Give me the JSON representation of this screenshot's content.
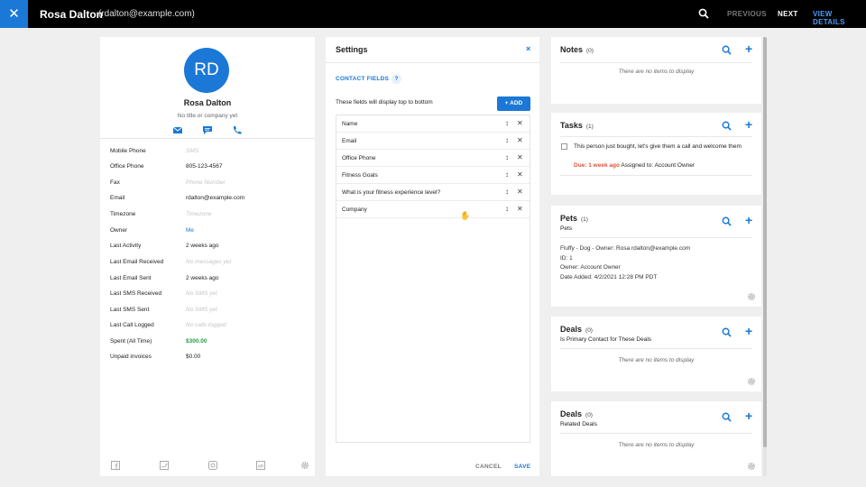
{
  "topbar": {
    "close_icon": "close-icon",
    "contact_name": "Rosa Dalton",
    "contact_email": "(rdalton@example.com)",
    "previous_label": "PREVIOUS",
    "next_label": "NEXT",
    "view_details_label": "VIEW DETAILS"
  },
  "profile": {
    "initials": "RD",
    "name": "Rosa Dalton",
    "subtitle": "No title or company yet",
    "accent": "#1b78d7",
    "fields": [
      {
        "label": "Mobile Phone",
        "value": "SMS",
        "placeholder": true
      },
      {
        "label": "Office Phone",
        "value": "805-123-4567"
      },
      {
        "label": "Fax",
        "value": "Phone Number",
        "placeholder": true
      },
      {
        "label": "Email",
        "value": "rdalton@example.com"
      },
      {
        "label": "Timezone",
        "value": "Timezone",
        "placeholder": true
      },
      {
        "label": "Owner",
        "value": "Me",
        "link": true
      },
      {
        "label": "Last Activity",
        "value": "2 weeks ago"
      },
      {
        "label": "Last Email Received",
        "value": "No messages yet",
        "placeholder": true
      },
      {
        "label": "Last Email Sent",
        "value": "2 weeks ago"
      },
      {
        "label": "Last SMS Received",
        "value": "No SMS yet",
        "placeholder": true
      },
      {
        "label": "Last SMS Sent",
        "value": "No SMS yet",
        "placeholder": true
      },
      {
        "label": "Last Call Logged",
        "value": "No calls logged",
        "placeholder": true
      },
      {
        "label": "Spent (All Time)",
        "value": "$300.00",
        "green": true
      },
      {
        "label": "Unpaid invoices",
        "value": "$0.00"
      }
    ]
  },
  "settings": {
    "title": "Settings",
    "close_glyph": "×",
    "section_label": "CONTACT FIELDS",
    "help_glyph": "?",
    "info": "These fields will display top to bottom",
    "add_label": "ADD",
    "fields": [
      "Name",
      "Email",
      "Office Phone",
      "Fitness Goals",
      "What is your fitness experience level?",
      "Company"
    ],
    "cancel_label": "CANCEL",
    "save_label": "SAVE"
  },
  "notes": {
    "title": "Notes",
    "count": "(0)",
    "empty": "There are no items to display"
  },
  "tasks": {
    "title": "Tasks",
    "count": "(1)",
    "item_text": "This person just bought, let's give them a call and welcome them",
    "due": "Due: 1 week ago",
    "assigned": "Assigned to: Account Owner",
    "due_color": "#e0543a"
  },
  "pets": {
    "title": "Pets",
    "count": "(1)",
    "subtitle": "Pets",
    "lines": [
      "Fluffy - Dog - Owner: Rosa rdalton@example.com",
      "ID: 1",
      "Owner: Account Owner",
      "Date Added: 4/2/2021 12:28 PM PDT"
    ]
  },
  "deals_primary": {
    "title": "Deals",
    "count": "(0)",
    "subtitle": "Is Primary Contact for These Deals",
    "empty": "There are no items to display"
  },
  "deals_related": {
    "title": "Deals",
    "count": "(0)",
    "subtitle": "Related Deals",
    "empty": "There are no items to display"
  }
}
